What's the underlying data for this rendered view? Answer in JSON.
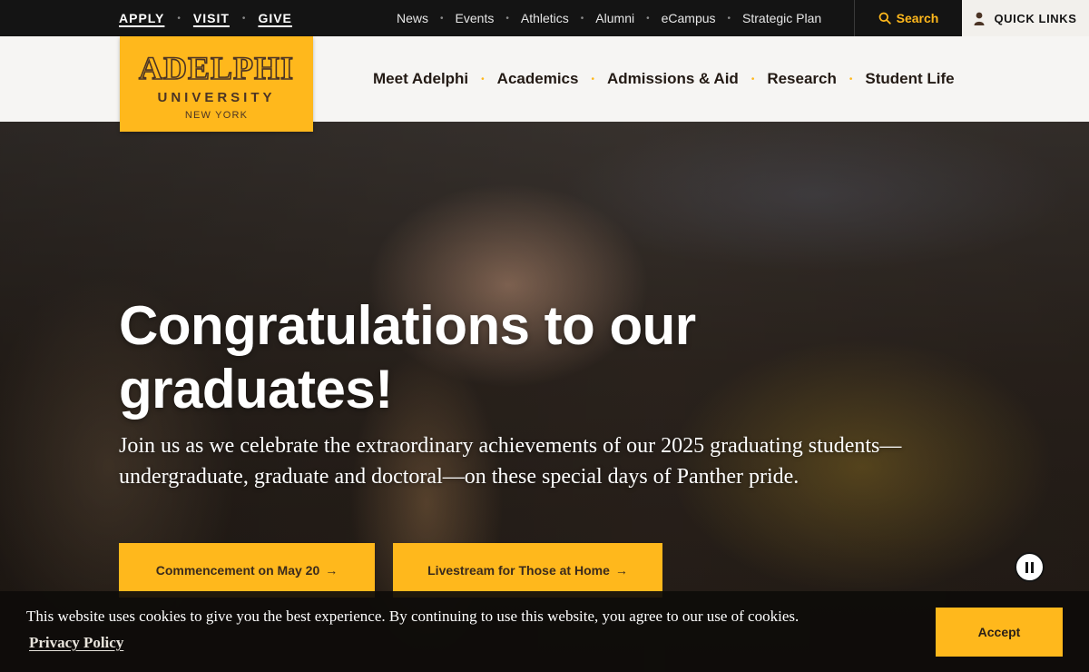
{
  "utility": {
    "cta": [
      "APPLY",
      "VISIT",
      "GIVE"
    ],
    "links": [
      "News",
      "Events",
      "Athletics",
      "Alumni",
      "eCampus",
      "Strategic Plan"
    ],
    "search_label": "Search",
    "quick_links_label": "QUICK LINKS"
  },
  "logo": {
    "line1": "ADELPHI",
    "line2": "UNIVERSITY",
    "line3": "NEW YORK"
  },
  "main_nav": [
    "Meet Adelphi",
    "Academics",
    "Admissions & Aid",
    "Research",
    "Student Life"
  ],
  "hero": {
    "title": "Congratulations to our graduates!",
    "body": "Join us as we celebrate the extraordinary achievements of our 2025 graduating students—undergraduate, graduate and doctoral—on these special days of Panther pride.",
    "button1": "Commencement on May 20",
    "button2": "Livestream for Those at Home",
    "arrow": "→"
  },
  "cookie": {
    "message": "This website uses cookies to give you the best experience. By continuing to use this website, you agree to our use of cookies.",
    "policy_link": "Privacy Policy",
    "accept_label": "Accept"
  },
  "colors": {
    "brand_gold": "#ffb81c",
    "brand_brown": "#4b3425",
    "utility_bg": "#141414"
  },
  "icons": {
    "search": "search-icon",
    "user": "user-icon",
    "pause": "pause-icon",
    "arrow": "arrow-right-icon"
  }
}
